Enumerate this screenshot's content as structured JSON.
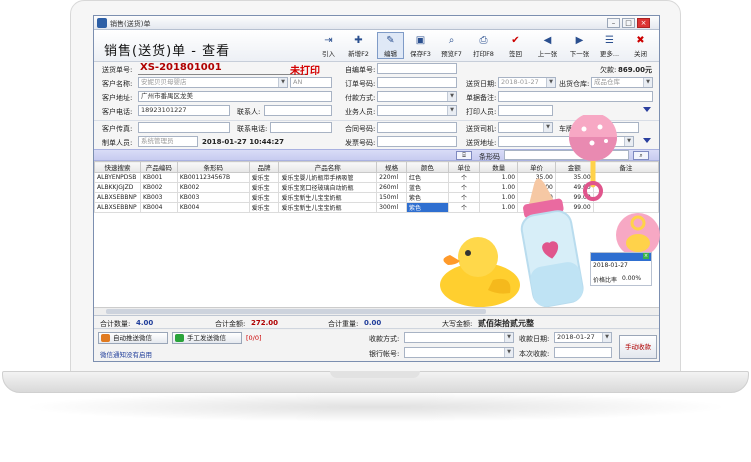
{
  "window": {
    "title": "销售(送货)单",
    "page_title": "销售(送货)单 - 查看"
  },
  "toolbar": {
    "buttons": [
      {
        "label": "引入",
        "icon": "import-icon"
      },
      {
        "label": "新增F2",
        "icon": "new-icon"
      },
      {
        "label": "编辑",
        "icon": "edit-icon"
      },
      {
        "label": "保存F3",
        "icon": "save-icon"
      },
      {
        "label": "预览F7",
        "icon": "preview-icon"
      },
      {
        "label": "打印F8",
        "icon": "print-icon"
      },
      {
        "label": "签回",
        "icon": "checkmark-icon"
      },
      {
        "label": "上一张",
        "icon": "arrow-left-icon"
      },
      {
        "label": "下一张",
        "icon": "arrow-right-icon"
      },
      {
        "label": "更多...",
        "icon": "more-icon"
      },
      {
        "label": "关闭",
        "icon": "close-icon"
      }
    ]
  },
  "form": {
    "order_no_label": "送货单号:",
    "order_no": "XS-201801001",
    "print_status": "未打印",
    "custom_no_label": "自编单号:",
    "debt_label": "欠款:",
    "debt_value": "869.00元",
    "customer_name_label": "客户名称:",
    "customer_name": "安妮贝贝母婴店",
    "customer_code": "AN",
    "order_ref_label": "订单号码:",
    "delivery_date_label": "送货日期:",
    "delivery_date": "2018-01-27",
    "warehouse_label": "出货仓库:",
    "warehouse": "成品仓库",
    "address_label": "客户地址:",
    "address": "广州市番禺区龙美",
    "payment_label": "付款方式:",
    "remark_label": "单据备注:",
    "phone_label": "客户电话:",
    "phone": "18923101227",
    "contact_label": "联系人:",
    "salesman_label": "业务人员:",
    "printer_label": "打印人员:",
    "fax_label": "客户传真:",
    "contact_phone_label": "联系电话:",
    "contract_label": "合同号码:",
    "driver_label": "送货司机:",
    "vehicle_label": "车牌号码:",
    "creator_label": "制单人员:",
    "creator": "系统管理员",
    "created_time": "2018-01-27 10:44:27",
    "invoice_label": "发票号码:",
    "dest_label": "送货地址:"
  },
  "barcode": {
    "label": "条形码"
  },
  "table": {
    "columns": [
      "快速搜索",
      "产品编码",
      "条形码",
      "品牌",
      "产品名称",
      "规格",
      "颜色",
      "单位",
      "数量",
      "单价",
      "金额",
      "备注"
    ],
    "rows": [
      [
        "ALBYENPDSB",
        "KB001",
        "KB0011234567B",
        "爱乐宝",
        "爱乐宝婴儿奶瓶带手柄吸管",
        "220ml",
        "红色",
        "个",
        "1.00",
        "35.00",
        "35.00",
        ""
      ],
      [
        "ALBKKJGJZD",
        "KB002",
        "KB002",
        "爱乐宝",
        "爱乐宝宽口径玻璃自动奶瓶",
        "260ml",
        "蓝色",
        "个",
        "1.00",
        "49.00",
        "49.00",
        ""
      ],
      [
        "ALBXSEBBNP",
        "KB003",
        "KB003",
        "爱乐宝",
        "爱乐宝新生儿宝宝奶瓶",
        "150ml",
        "紫色",
        "个",
        "1.00",
        "99.00",
        "99.00",
        ""
      ],
      [
        "ALBXSEBBNP",
        "KB004",
        "KB004",
        "爱乐宝",
        "爱乐宝新生儿宝宝奶瓶",
        "300ml",
        "紫色",
        "个",
        "1.00",
        "99.00",
        "99.00",
        ""
      ]
    ]
  },
  "totals": {
    "qty_label": "合计数量:",
    "qty": "4.00",
    "amount_label": "合计金额:",
    "amount": "272.00",
    "weight_label": "合计重量:",
    "weight": "0.00",
    "capital_label": "大写金额:",
    "capital": "贰佰柒拾贰元整"
  },
  "bottom": {
    "auto_wechat": "自动推送微信",
    "manual_wechat": "手工发送微信",
    "count_note": "[0/0]",
    "wechat_note": "微信通知没有启用",
    "receive_method_label": "收款方式:",
    "receive_date_label": "收款日期:",
    "receive_date": "2018-01-27",
    "bank_label": "银行帐号:",
    "this_receive_label": "本次收款:",
    "manual_receive": "手动收款"
  },
  "side_popup": {
    "date": "2018-01-27",
    "price_ratio_label": "价格比率",
    "price_ratio": "0.00%"
  },
  "colors": {
    "accent": "#2f6fd0",
    "order_red": "#b00000",
    "barcode_bar": "#c7cbf0"
  }
}
